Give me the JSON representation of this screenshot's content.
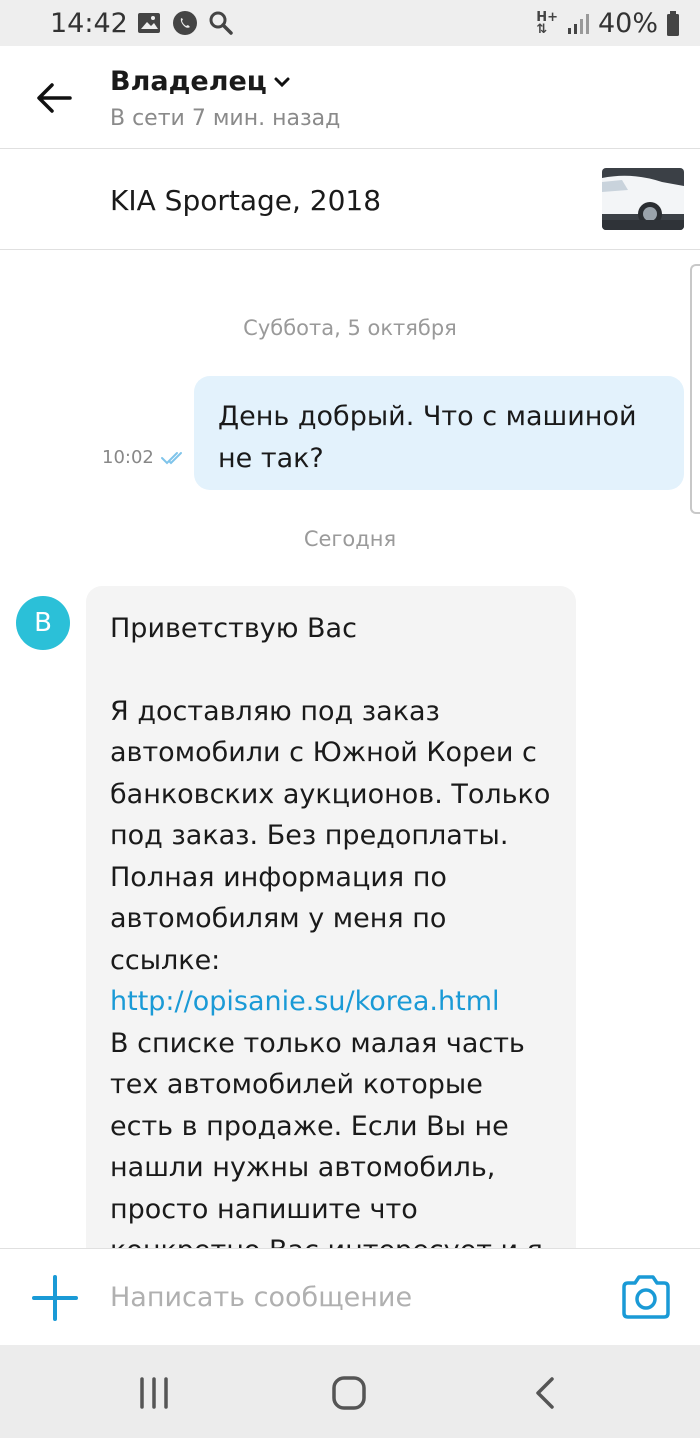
{
  "status_bar": {
    "time": "14:42",
    "network": "H+",
    "battery": "40%",
    "icons": [
      "gallery-icon",
      "whatsapp-icon",
      "search-icon",
      "signal-icon",
      "battery-icon"
    ]
  },
  "header": {
    "title": "Владелец",
    "subtitle": "В сети 7 мин. назад"
  },
  "listing": {
    "name": "KIA Sportage, 2018"
  },
  "chat": {
    "date_1": "Суббота, 5 октября",
    "outgoing": {
      "text": "День добрый.  Что с машиной не так?",
      "time": "10:02",
      "status": "read"
    },
    "date_2": "Сегодня",
    "incoming": {
      "avatar_letter": "В",
      "greeting": "Приветствую Вас",
      "body_1": "Я доставляю под заказ автомобили с Южной Кореи с банковских аукционов. Только под заказ. Без предоплаты. Полная информация по автомобилям у меня по ссылке:",
      "link": "http://opisanie.su/korea.html",
      "body_2": "В списке только малая часть тех автомобилей которые есть в продаже. Если Вы не нашли нужны автомобиль,",
      "body_3": "просто напишите что конкретно Вас интересует и я"
    }
  },
  "composer": {
    "placeholder": "Написать сообщение"
  },
  "colors": {
    "accent": "#1a9ad6",
    "outgoing_bubble": "#e3f2fc",
    "incoming_bubble": "#f4f4f4",
    "avatar": "#2bc0d8"
  }
}
